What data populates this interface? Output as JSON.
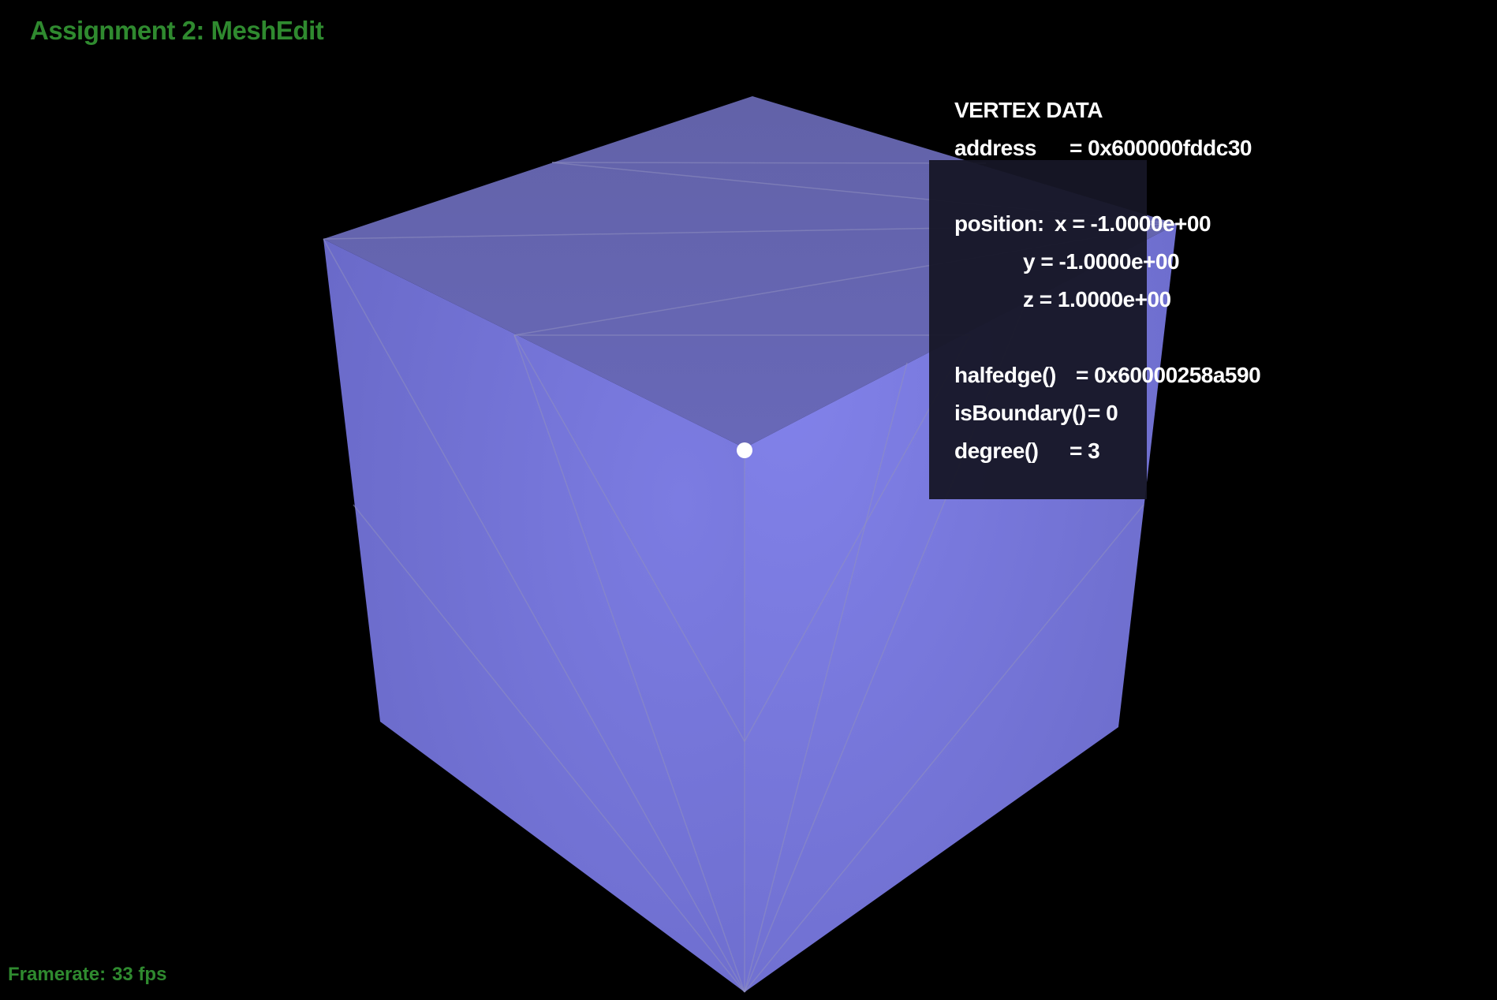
{
  "app": {
    "title": "Assignment 2: MeshEdit"
  },
  "status": {
    "framerate_label": "Framerate:",
    "framerate_value": "33 fps"
  },
  "vertex_data": {
    "heading": "VERTEX DATA",
    "address_label": "address",
    "address_value": "= 0x600000fddc30",
    "position_label": "position:",
    "x": "x = -1.0000e+00",
    "y": "y = -1.0000e+00",
    "z": "z = 1.0000e+00",
    "halfedge_label": "halfedge()",
    "halfedge_value": "= 0x60000258a590",
    "isboundary_label": "isBoundary()",
    "isboundary_value": "= 0",
    "degree_label": "degree()",
    "degree_value": "= 3"
  },
  "colors": {
    "background": "#000000",
    "title_green": "#2f8a2f",
    "mesh_face": "#7777dd",
    "selected_vertex": "#ffffff"
  }
}
